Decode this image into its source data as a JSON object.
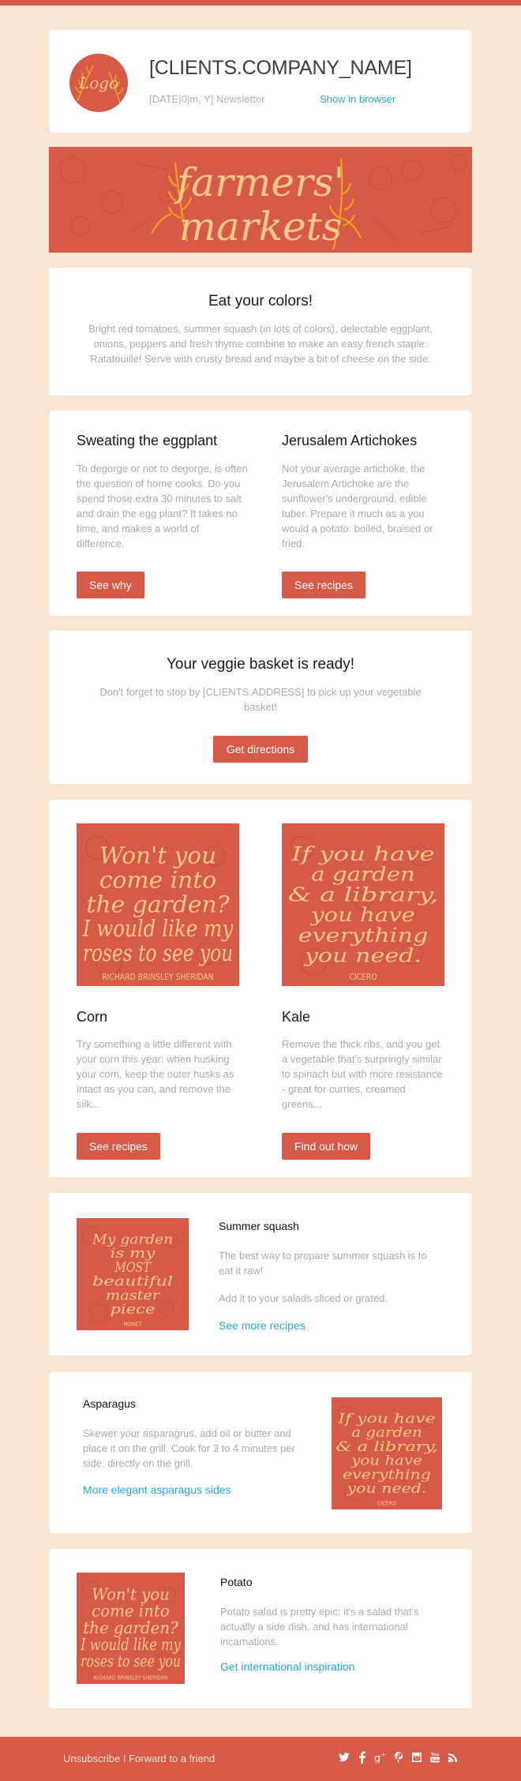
{
  "colors": {
    "accent": "#d55b48",
    "background": "#f8e6d3",
    "link": "#2ca4e0",
    "art_text": "#fcc98a",
    "art_leaf": "#f2a51c"
  },
  "header": {
    "logo_text": "Logo",
    "company_name": "[CLIENTS.COMPANY_NAME]",
    "date_line": "[DATE|0|m, Y] Newsletter",
    "show_in_browser": "Show in browser"
  },
  "hero": {
    "line1": "farmers'",
    "line2": "markets"
  },
  "intro": {
    "title": "Eat your colors!",
    "body": "Bright red tomatoes, summer squash (in lots of colors), delectable eggplant, onions, peppers and fresh thyme combine to make an easy french staple: Ratatouille! Serve with crusty bread and maybe a bit of cheese on the side."
  },
  "two_col": [
    {
      "title": "Sweating the eggplant",
      "body": "To degorge or not to degorge, is often the question of home cooks. Do you spend those extra 30 minutes to salt and drain the egg plant? It takes no time, and makes a world of difference.",
      "button": "See why"
    },
    {
      "title": "Jerusalem Artichokes",
      "body": "Not your average artichoke, the Jerusalem Artichoke are the sunflower's underground, edible tuber. Prepare it much as a you would a potato: boiled, braised or fried.",
      "button": "See recipes"
    }
  ],
  "basket": {
    "title": "Your veggie basket is ready!",
    "body": "Don't forget to stop by [CLIENTS.ADDRESS] to pick up your vegetable basket!",
    "button": "Get directions"
  },
  "image_cols": [
    {
      "art": {
        "lines": [
          "Won't you",
          "come into",
          "the garden?",
          "I would like my",
          "roses to see you"
        ],
        "credit": "RICHARD BRINSLEY SHERIDAN"
      },
      "title": "Corn",
      "body": "Try something a little different with your corn this year: when husking your corn, keep the outer husks as intact as you can, and remove the silk...",
      "button": "See recipes"
    },
    {
      "art": {
        "lines": [
          "If you have",
          "a garden",
          "& a library,",
          "you have",
          "everything",
          "you need."
        ],
        "credit": "CICERO"
      },
      "title": "Kale",
      "body": "Remove the thick ribs, and you get a vegetable that's surpringly similar to spinach but with more resistance - great for curries, creamed greens...",
      "button": "Find out how"
    }
  ],
  "side_items": [
    {
      "art": {
        "lines": [
          "My garden",
          "is my",
          "MOST",
          "beautiful",
          "master",
          "piece"
        ],
        "credit": "MONET"
      },
      "title": "Summer squash",
      "body1": "The best way to prepare summer squash is to eat it raw!",
      "body2": "Add it to your salads sliced or grated.",
      "link": "See more recipes"
    },
    {
      "art": {
        "lines": [
          "If you have",
          "a garden",
          "& a library,",
          "you have",
          "everything",
          "you need."
        ],
        "credit": "CICERO"
      },
      "title": "Asparagus",
      "body1": "Skewer your asparagrus, add oil or butter and place it on the grill. Cook for 3 to 4 minutes per side, directly on the grill.",
      "link": "More elegant asparagus sides"
    },
    {
      "art": {
        "lines": [
          "Won't you",
          "come into",
          "the garden?",
          "I would like my",
          "roses to see you"
        ],
        "credit": "RICHARD BRINSLEY SHERIDAN"
      },
      "title": "Potato",
      "body1": "Potato salad is pretty epic: it's a salad that's actually a side dish, and has international incarnations.",
      "link": "Get international inspiration"
    }
  ],
  "footer": {
    "unsubscribe": "Unsubscribe",
    "separator": " I ",
    "forward": "Forward to a friend",
    "social_icons": [
      "twitter-icon",
      "facebook-icon",
      "google-plus-icon",
      "pinterest-icon",
      "instagram-icon",
      "youtube-icon",
      "rss-icon"
    ]
  }
}
